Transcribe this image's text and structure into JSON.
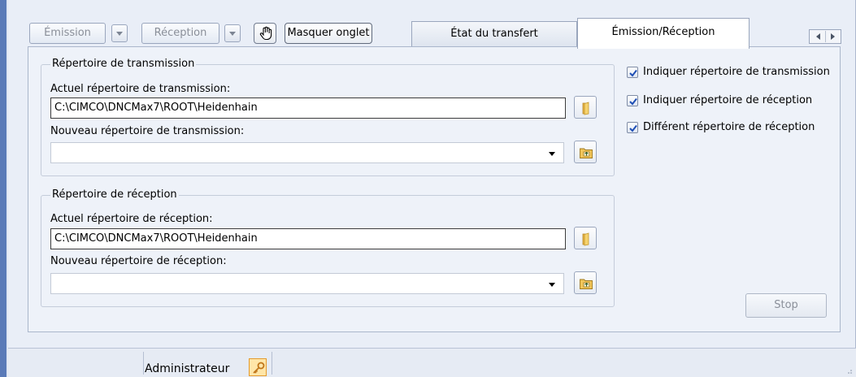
{
  "toolbar": {
    "emission_label": "Émission",
    "reception_label": "Réception",
    "masquer_label": "Masquer onglet"
  },
  "tabs": [
    {
      "label": "État du transfert",
      "active": false
    },
    {
      "label": "Émission/Réception",
      "active": true
    }
  ],
  "transmission": {
    "legend": "Répertoire de transmission",
    "current_label": "Actuel répertoire de transmission:",
    "current_value": "C:\\CIMCO\\DNCMax7\\ROOT\\Heidenhain",
    "new_label": "Nouveau répertoire de transmission:",
    "new_value": ""
  },
  "reception": {
    "legend": "Répertoire de réception",
    "current_label": "Actuel répertoire de réception:",
    "current_value": "C:\\CIMCO\\DNCMax7\\ROOT\\Heidenhain",
    "new_label": "Nouveau répertoire de réception:",
    "new_value": ""
  },
  "options": [
    {
      "label": "Indiquer répertoire de transmission",
      "checked": true
    },
    {
      "label": "Indiquer répertoire de réception",
      "checked": true
    },
    {
      "label": "Différent répertoire de réception",
      "checked": true
    }
  ],
  "stop_label": "Stop",
  "status": {
    "user": "Administrateur",
    "user_icon": "key-icon"
  },
  "colors": {
    "accent": "#5a7ab8",
    "panel_bg": "#eef2f9",
    "disabled_text": "#8a8f99"
  }
}
